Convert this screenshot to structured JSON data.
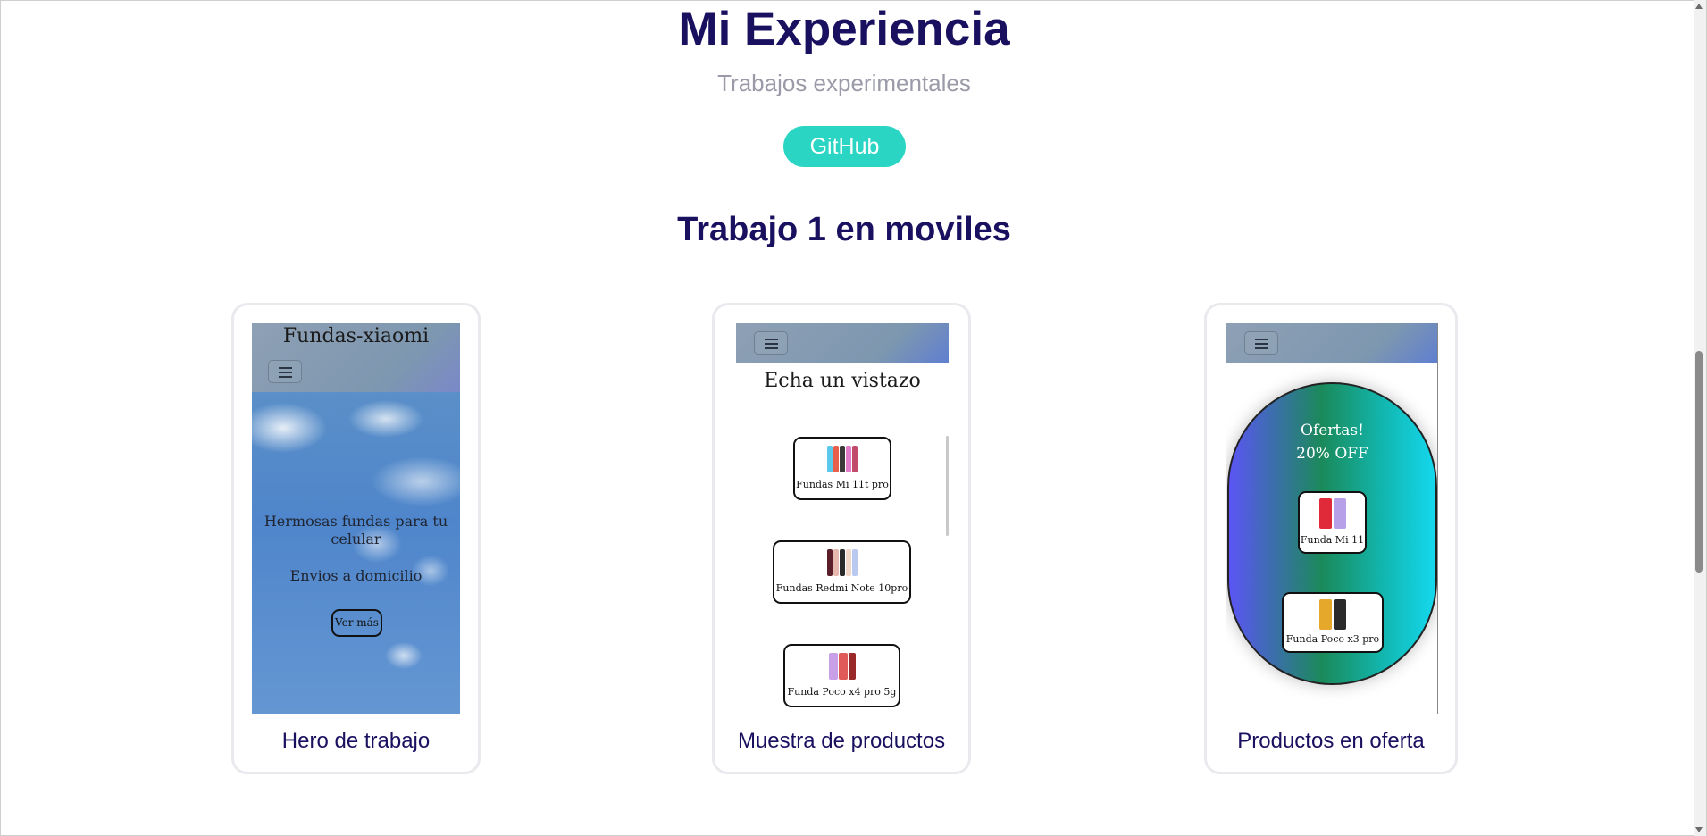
{
  "header": {
    "title": "Mi Experiencia",
    "subtitle": "Trabajos experimentales",
    "github_label": "GitHub"
  },
  "section": {
    "title": "Trabajo 1 en moviles"
  },
  "cards": [
    {
      "caption": "Hero de trabajo",
      "preview": {
        "brand": "Fundas-xiaomi",
        "headline": "Hermosas fundas para tu celular",
        "subline": "Envios a domicilio",
        "button": "Ver más"
      }
    },
    {
      "caption": "Muestra de productos",
      "preview": {
        "heading": "Echa un vistazo",
        "products": [
          "Fundas Mi 11t pro",
          "Fundas Redmi Note 10pro",
          "Funda Poco x4 pro 5g"
        ]
      }
    },
    {
      "caption": "Productos en oferta",
      "preview": {
        "offer_line1": "Ofertas!",
        "offer_line2": "20% OFF",
        "products": [
          "Funda Mi 11",
          "Funda Poco x3 pro"
        ]
      }
    }
  ],
  "colors": {
    "title": "#1a1060",
    "subtitle": "#9a9aa8",
    "github_button": "#2ad6c3",
    "card_border": "#e9e9ee"
  }
}
